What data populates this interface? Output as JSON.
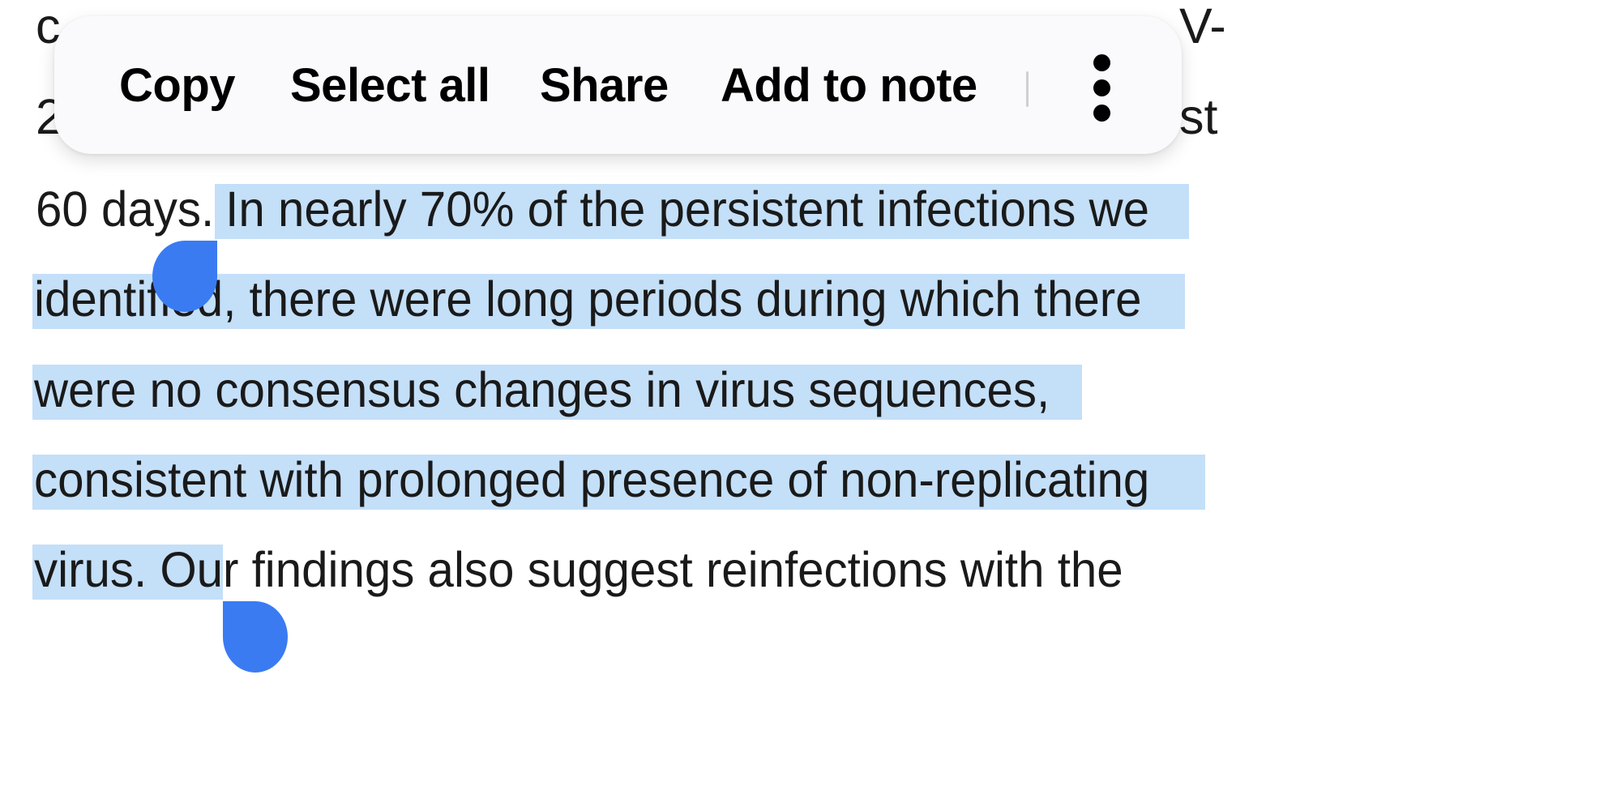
{
  "popup_menu": {
    "items": [
      {
        "label": "Copy"
      },
      {
        "label": "Select all"
      },
      {
        "label": "Share"
      },
      {
        "label": "Add to note"
      }
    ],
    "more_icon": "more-vertical-icon"
  },
  "article": {
    "lines": [
      {
        "before": "c",
        "tail": "V-"
      },
      {
        "before": "2",
        "tail": "st"
      },
      {
        "plain": "60 days.",
        "selected": " In nearly 70% of the persistent infections we"
      },
      {
        "selected": "identified, there were long periods during which there"
      },
      {
        "selected": "were no consensus changes in virus sequences,"
      },
      {
        "selected": "consistent with prolonged presence of non-replicating"
      },
      {
        "selected": "virus. Ou",
        "plain": "r findings also suggest reinfections with the"
      }
    ]
  },
  "selection": {
    "highlight_color": "#c4dff8",
    "handle_color": "#3a7bf2"
  }
}
